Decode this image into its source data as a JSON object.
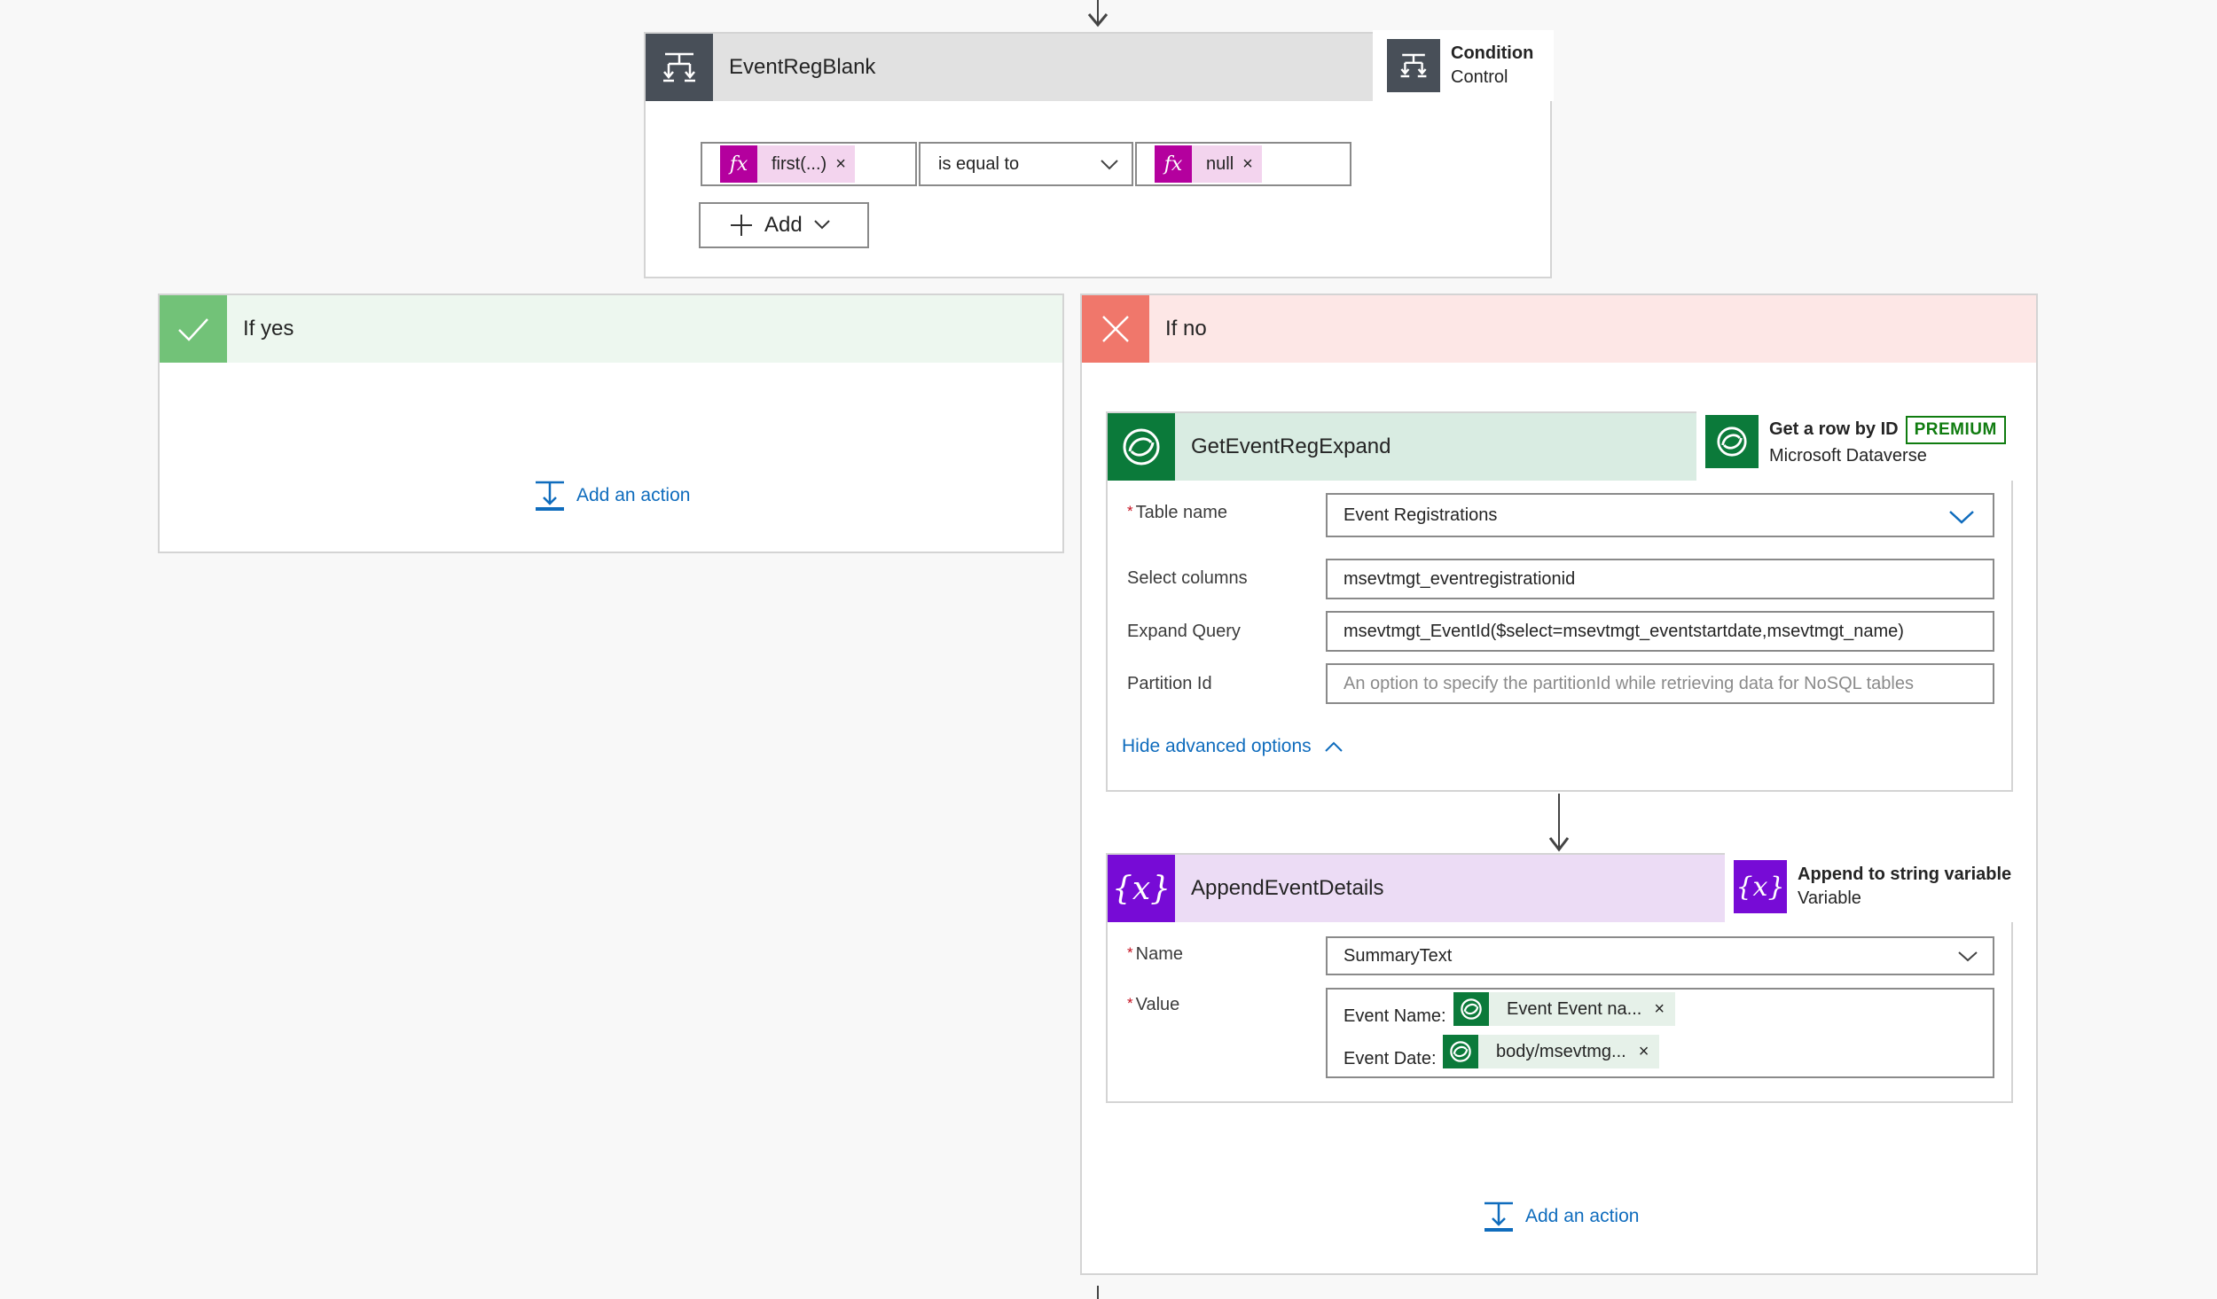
{
  "condition": {
    "title": "EventRegBlank",
    "badge_title": "Condition",
    "badge_subtitle": "Control",
    "left_operand": "first(...)",
    "operator": "is equal to",
    "right_operand": "null",
    "add_label": "Add",
    "token_icon_label": "fx",
    "remove_glyph": "×"
  },
  "if_yes": {
    "title": "If yes",
    "add_action": "Add an action"
  },
  "if_no": {
    "title": "If no",
    "add_action": "Add an action"
  },
  "get_row": {
    "title": "GetEventRegExpand",
    "badge_title": "Get a row by ID",
    "badge_premium": "PREMIUM",
    "badge_subtitle": "Microsoft Dataverse",
    "fields": {
      "table_name_label": "Table name",
      "table_name_value": "Event Registrations",
      "select_columns_label": "Select columns",
      "select_columns_value": "msevtmgt_eventregistrationid",
      "expand_query_label": "Expand Query",
      "expand_query_value": "msevtmgt_EventId($select=msevtmgt_eventstartdate,msevtmgt_name)",
      "partition_id_label": "Partition Id",
      "partition_id_placeholder": "An option to specify the partitionId while retrieving data for NoSQL tables"
    },
    "hide_advanced": "Hide advanced options"
  },
  "append": {
    "title": "AppendEventDetails",
    "badge_title": "Append to string variable",
    "badge_subtitle": "Variable",
    "variable_icon_label": "{x}",
    "name_label": "Name",
    "name_value": "SummaryText",
    "value_label": "Value",
    "line1_prefix": "Event Name:",
    "line1_token": "Event Event na...",
    "line2_prefix": "Event Date:",
    "line2_token": "body/msevtmg..."
  },
  "colors": {
    "condition_header": "#484f58",
    "yes_green": "#72c278",
    "yes_bg": "#edf7ef",
    "no_red": "#f0776b",
    "no_bg": "#fde7e6",
    "dataverse_green": "#0b7a3a",
    "dataverse_bg": "#d9ece2",
    "variable_purple": "#770bd6",
    "variable_bg": "#ecdcf5",
    "link_blue": "#0f6cbd"
  }
}
